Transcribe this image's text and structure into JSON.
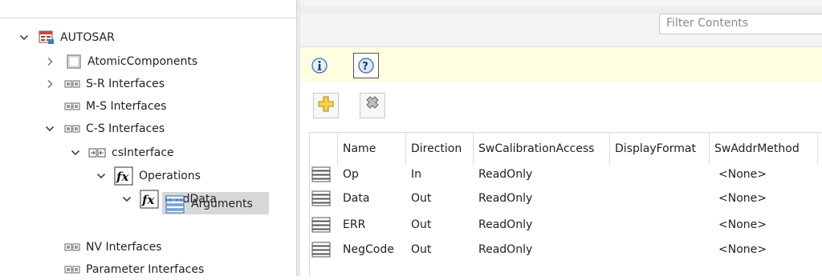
{
  "tree": {
    "items": [
      {
        "label": "AUTOSAR",
        "expanded": true,
        "icon": "autosar-root-icon"
      },
      {
        "label": "AtomicComponents",
        "expanded": false,
        "icon": "folder-icon"
      },
      {
        "label": "S-R Interfaces",
        "expanded": false,
        "icon": "interface-icon"
      },
      {
        "label": "M-S Interfaces",
        "icon": "interface-icon"
      },
      {
        "label": "C-S Interfaces",
        "expanded": true,
        "icon": "interface-icon"
      },
      {
        "label": "csInterface",
        "expanded": true,
        "icon": "cs-interface-icon"
      },
      {
        "label": "Operations",
        "expanded": true,
        "icon": "fx-icon"
      },
      {
        "label": "readData",
        "expanded": true,
        "icon": "fx-icon"
      },
      {
        "label": "Arguments",
        "selected": true,
        "icon": "arguments-icon"
      },
      {
        "label": "NV Interfaces",
        "icon": "interface-icon"
      },
      {
        "label": "Parameter Interfaces",
        "icon": "interface-icon"
      }
    ]
  },
  "filter": {
    "placeholder": "Filter Contents"
  },
  "infobar": {
    "info_icon": "info-icon",
    "help_icon": "help-icon",
    "background": "#fefee0"
  },
  "toolbar": {
    "add_icon": "add-icon",
    "delete_icon": "delete-icon"
  },
  "table": {
    "columns": [
      "Name",
      "Direction",
      "SwCalibrationAccess",
      "DisplayFormat",
      "SwAddrMethod"
    ],
    "rows": [
      {
        "Name": "Op",
        "Direction": "In",
        "SwCalibrationAccess": "ReadOnly",
        "DisplayFormat": "",
        "SwAddrMethod": "<None>"
      },
      {
        "Name": "Data",
        "Direction": "Out",
        "SwCalibrationAccess": "ReadOnly",
        "DisplayFormat": "",
        "SwAddrMethod": "<None>"
      },
      {
        "Name": "ERR",
        "Direction": "Out",
        "SwCalibrationAccess": "ReadOnly",
        "DisplayFormat": "",
        "SwAddrMethod": "<None>"
      },
      {
        "Name": "NegCode",
        "Direction": "Out",
        "SwCalibrationAccess": "ReadOnly",
        "DisplayFormat": "",
        "SwAddrMethod": "<None>"
      }
    ]
  },
  "colors": {
    "selected_row": "#d8d8d8",
    "accent_blue": "#3c7fc4",
    "add_icon_yellow": "#f2c200"
  }
}
